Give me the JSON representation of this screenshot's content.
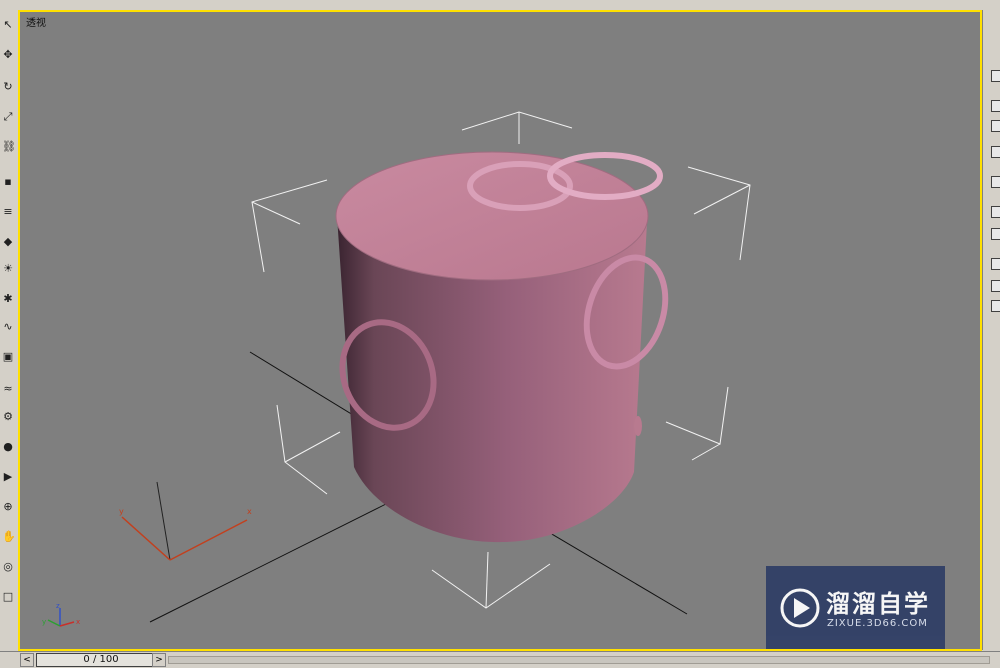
{
  "viewport": {
    "label": "透视",
    "scene_objects": [
      {
        "name": "Cylinder",
        "color": "#b87a8f"
      },
      {
        "name": "Torus ring",
        "color": "#c98aa6",
        "count": 5
      }
    ],
    "axis_labels": {
      "x": "x",
      "y": "y",
      "z": "z"
    }
  },
  "timeline": {
    "frame_display": "0 / 100",
    "prev_arrow": "<",
    "next_arrow": ">"
  },
  "watermark": {
    "brand": "溜溜自学",
    "url": "ZIXUE.3D66.COM"
  },
  "left_toolbar": {
    "icons": [
      "select-icon",
      "move-icon",
      "rotate-icon",
      "scale-icon",
      "link-icon",
      "unlink-icon",
      "bind-icon",
      "camera-icon",
      "light-icon",
      "helper-icon",
      "shape-icon",
      "geometry-icon",
      "space-warp-icon",
      "system-icon",
      "material-icon",
      "render-icon",
      "zoom-icon",
      "pan-icon",
      "orbit-icon",
      "maximize-icon"
    ]
  },
  "colors": {
    "viewport_bg": "#7f7f7f",
    "active_border": "#ffe000",
    "ui_gray": "#d4d0c8",
    "object_pink": "#b87a8f"
  }
}
